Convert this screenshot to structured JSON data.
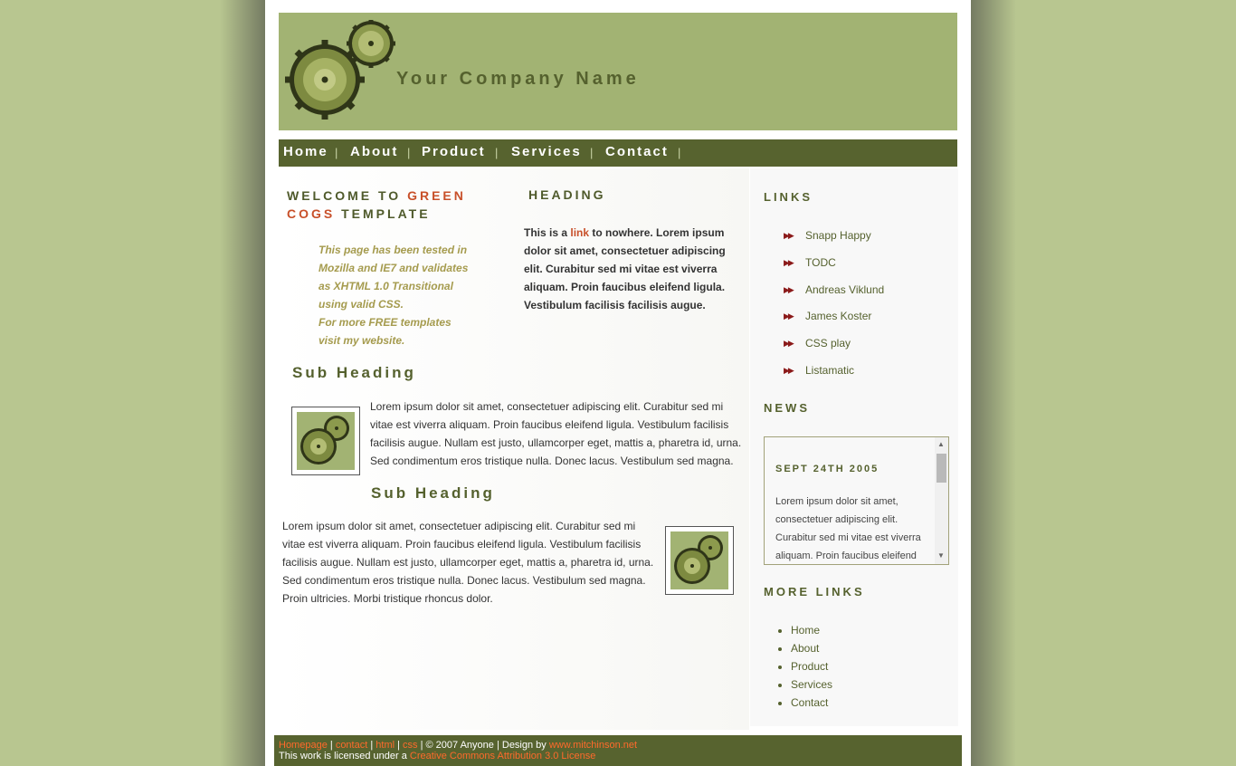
{
  "header": {
    "company_name": "Your Company Name"
  },
  "nav": {
    "items": [
      {
        "label": "Home"
      },
      {
        "label": "About"
      },
      {
        "label": "Product"
      },
      {
        "label": "Services"
      },
      {
        "label": "Contact"
      }
    ],
    "separator": "|"
  },
  "welcome": {
    "prefix": "WELCOME TO ",
    "accent": "GREEN COGS",
    "suffix": " TEMPLATE",
    "note_lines": [
      "This page has been tested in",
      "Mozilla and IE7 and validates",
      "as XHTML 1.0 Transitional",
      "using valid CSS.",
      "For more FREE templates",
      "visit my website."
    ]
  },
  "col2": {
    "heading": "HEADING",
    "text_before": "This is a ",
    "link_text": "link",
    "text_after": " to nowhere. Lorem ipsum dolor sit amet, consectetuer adipiscing elit. Curabitur sed mi vitae est viverra aliquam. Proin faucibus eleifend ligula. Vestibulum facilisis facilisis augue."
  },
  "section1": {
    "sub_heading": "Sub Heading",
    "text": "Lorem ipsum dolor sit amet, consectetuer adipiscing elit. Curabitur sed mi vitae est viverra aliquam. Proin faucibus eleifend ligula. Vestibulum facilisis facilisis augue. Nullam est justo, ullamcorper eget, mattis a, pharetra id, urna. Sed condimentum eros tristique nulla. Donec lacus. Vestibulum sed magna."
  },
  "section2": {
    "sub_heading": "Sub Heading",
    "text": "Lorem ipsum dolor sit amet, consectetuer adipiscing elit. Curabitur sed mi vitae est viverra aliquam. Proin faucibus eleifend ligula. Vestibulum facilisis facilisis augue. Nullam est justo, ullamcorper eget, mattis a, pharetra id, urna. Sed condimentum eros tristique nulla. Donec lacus. Vestibulum sed magna. Proin ultricies. Morbi tristique rhoncus dolor."
  },
  "sidebar": {
    "links_heading": "LINKS",
    "links": [
      "Snapp Happy",
      "TODC",
      "Andreas Viklund",
      "James Koster",
      "CSS play",
      "Listamatic"
    ],
    "news_heading": "NEWS",
    "news_date": "SEPT 24TH 2005",
    "news_text": "Lorem ipsum dolor sit amet, consectetuer adipiscing elit. Curabitur sed mi vitae est viverra aliquam. Proin faucibus eleifend",
    "more_links_heading": "MORE LINKS",
    "more_links": [
      "Home",
      "About",
      "Product",
      "Services",
      "Contact"
    ]
  },
  "footer": {
    "links": [
      "Homepage",
      "contact",
      "html",
      "css"
    ],
    "separator": "|",
    "copyright": "© 2007 Anyone | Design by ",
    "designer_link": "www.mitchinson.net",
    "license_prefix": "This work is licensed under a ",
    "license_link": "Creative Commons Attribution 3.0 License"
  },
  "colors": {
    "background": "#b8c690",
    "header": "#a2b373",
    "nav": "#57632f",
    "accent": "#c8502a",
    "text_green": "#55612e"
  }
}
